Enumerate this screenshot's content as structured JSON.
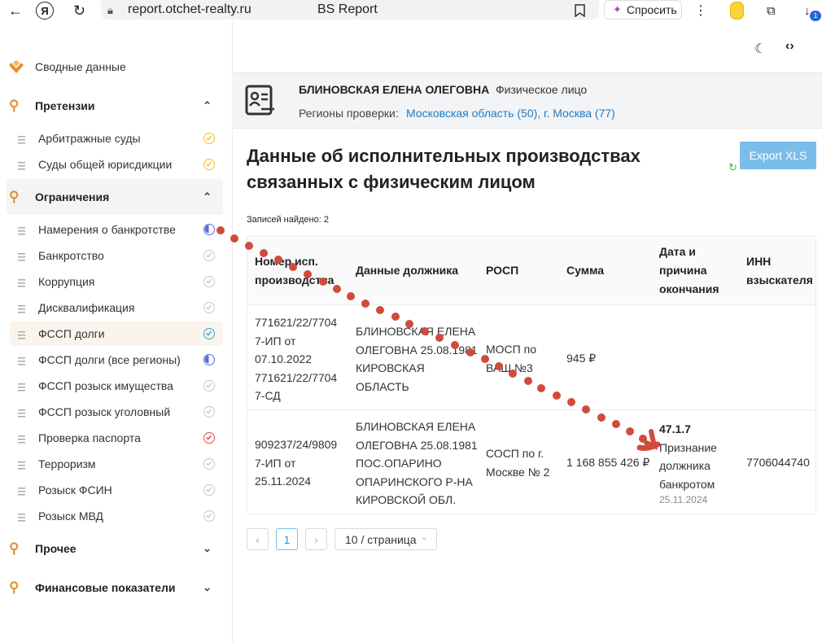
{
  "browser": {
    "url": "report.otchet-realty.ru",
    "tab_title": "BS Report",
    "ask_label": "Спросить",
    "download_badge": "1"
  },
  "sidebar": {
    "summary_label": "Сводные данные",
    "sections": {
      "claims": {
        "label": "Претензии"
      },
      "restrictions": {
        "label": "Ограничения"
      },
      "other": {
        "label": "Прочее"
      },
      "finance": {
        "label": "Финансовые показатели"
      }
    },
    "claims_items": [
      "Арбитражные суды",
      "Суды общей юрисдикции"
    ],
    "restriction_items": [
      "Намерения о банкротстве",
      "Банкротство",
      "Коррупция",
      "Дисквалификация",
      "ФССП долги",
      "ФССП долги (все регионы)",
      "ФССП розыск имущества",
      "ФССП розыск уголовный",
      "Проверка паспорта",
      "Терроризм",
      "Розыск ФСИН",
      "Розыск МВД"
    ],
    "active_item": "ФССП долги",
    "colors": {
      "accent": "#e98d2b",
      "check_yellow": "#f2c21b",
      "check_blue": "#3aa5d8",
      "check_red": "#e24b4b",
      "check_grey": "#c8c8c8",
      "progress_purple": "#5b6bd3"
    }
  },
  "person": {
    "name": "БЛИНОВСКАЯ ЕЛЕНА ОЛЕГОВНА",
    "type": "Физическое лицо",
    "regions_label": "Регионы проверки:",
    "regions_value": "Московская область (50), г. Москва (77)"
  },
  "content": {
    "title_line1": "Данные об исполнительных производствах",
    "title_line2": "связанных с физическим лицом",
    "export_label": "Export XLS",
    "records_found": "Записей найдено: 2"
  },
  "table": {
    "headers": {
      "number": [
        "Номер исп.",
        "производства"
      ],
      "debtor": "Данные должника",
      "rosp": "РОСП",
      "sum": "Сумма",
      "end": [
        "Дата и",
        "причина",
        "окончания"
      ],
      "inn": [
        "ИНН",
        "взыскателя"
      ]
    },
    "rows": [
      {
        "number": [
          "771621/22/7704",
          "7-ИП от",
          "07.10.2022",
          "771621/22/7704",
          "7-СД"
        ],
        "debtor": [
          "БЛИНОВСКАЯ ЕЛЕНА",
          "ОЛЕГОВНА 25.08.1981",
          "КИРОВСКАЯ",
          "ОБЛАСТЬ"
        ],
        "rosp": [
          "МОСП по",
          "ВАШ №3"
        ],
        "sum": "945 ₽",
        "end_code": "",
        "end_text": [],
        "end_date": "",
        "inn": ""
      },
      {
        "number": [
          "909237/24/9809",
          "7-ИП от",
          "25.11.2024"
        ],
        "debtor": [
          "БЛИНОВСКАЯ ЕЛЕНА",
          "ОЛЕГОВНА 25.08.1981",
          "ПОС.ОПАРИНО",
          "ОПАРИНСКОГО Р-НА",
          "КИРОВСКОЙ ОБЛ."
        ],
        "rosp": [
          "СОСП по г.",
          "Москве № 2"
        ],
        "sum": "1 168 855 426 ₽",
        "end_code": "47.1.7",
        "end_text": [
          "Признание",
          "должника",
          "банкротом"
        ],
        "end_date": "25.11.2024",
        "inn": "7706044740"
      }
    ]
  },
  "pagination": {
    "current_page": "1",
    "page_size": "10 / страница"
  }
}
